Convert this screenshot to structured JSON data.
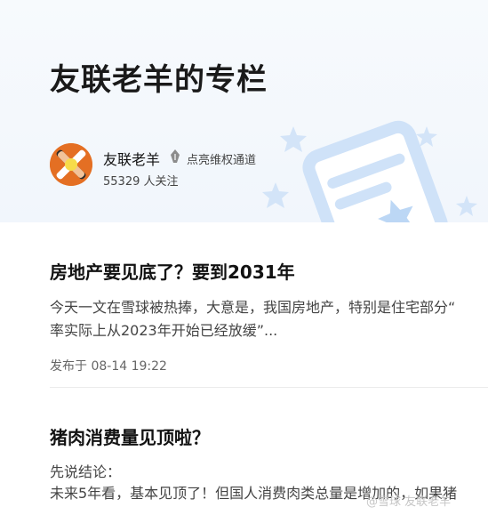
{
  "column": {
    "title": "友联老羊的专栏",
    "author_name": "友联老羊",
    "badge_text": "点亮维权通道",
    "followers_text": "55329 人关注"
  },
  "articles": [
    {
      "title": "房地产要见底了？要到2031年",
      "excerpt_lines": [
        "今天一文在雪球被热捧，大意是，我国房地产，特别是住宅部分“",
        "率实际上从2023年开始已经放缓”..."
      ],
      "meta": "发布于 08-14 19:22"
    },
    {
      "title": "猪肉消费量见顶啦？",
      "excerpt_lines": [
        "先说结论：",
        "未来5年看，基本见顶了！但国人消费肉类总量是增加的，如果猪"
      ]
    }
  ],
  "watermark": "@雪球 友联老羊",
  "icons": {
    "avatar": "avatar-hands-logo",
    "badge": "fountain-pen-icon",
    "decoration": "stars-card-illustration"
  },
  "colors": {
    "header_bg": "#f3f7fc",
    "decoration": "#cfe2f8",
    "title": "#121212",
    "text_secondary": "#444444"
  }
}
